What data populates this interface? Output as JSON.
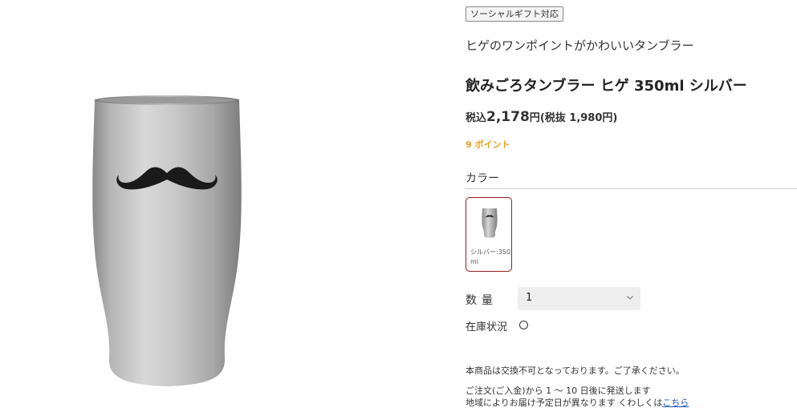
{
  "product": {
    "tag": "ソーシャルギフト対応",
    "catch_copy": "ヒゲのワンポイントがかわいいタンブラー",
    "name": "飲みごろタンブラー ヒゲ 350ml シルバー",
    "price": {
      "tax_in_label": "税込",
      "amount": "2,178",
      "yen": "円",
      "tax_ex_text": "(税抜 1,980円)"
    },
    "points": "9 ポイント",
    "image_icon": "tumbler-mustache-image"
  },
  "color": {
    "heading": "カラー",
    "options": [
      {
        "label": "シルバー:350ml",
        "selected": true
      }
    ],
    "accent": "#9b1b1b"
  },
  "quantity": {
    "label": "数量",
    "value": "1"
  },
  "stock": {
    "label": "在庫状況",
    "icon": "circle-icon"
  },
  "notes": {
    "exchange": "本商品は交換不可となっております。ご了承ください。",
    "shipping_line1": "ご注文(ご入金)から 1 ～ 10 日後に発送します",
    "shipping_line2": "地域によりお届け予定日が異なります くわしくは",
    "link_text": "こちら"
  },
  "colors": {
    "points": "#e6a01c",
    "link": "#1a55b8"
  }
}
